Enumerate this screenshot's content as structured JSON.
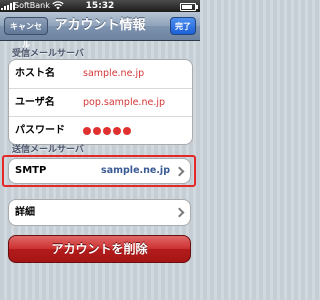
{
  "status_bar": {
    "carrier": "SoftBank",
    "time": "15:32",
    "battery_level": 0.85
  },
  "nav": {
    "cancel_label": "キャンセル",
    "title": "アカウント情報",
    "done_label": "完了"
  },
  "incoming": {
    "header": "受信メールサーバ",
    "rows": [
      {
        "label": "ホスト名",
        "value": "sample.ne.jp"
      },
      {
        "label": "ユーザ名",
        "value": "pop.sample.ne.jp"
      },
      {
        "label": "パスワード",
        "masked_length": 5
      }
    ]
  },
  "outgoing": {
    "header": "送信メールサーバ",
    "smtp_label": "SMTP",
    "smtp_value": "sample.ne.jp"
  },
  "advanced": {
    "label": "詳細"
  },
  "delete_button": {
    "label": "アカウントを削除"
  },
  "colors": {
    "value_red": "#d53636",
    "highlight": "#e42828",
    "delete": "#cc3030"
  }
}
